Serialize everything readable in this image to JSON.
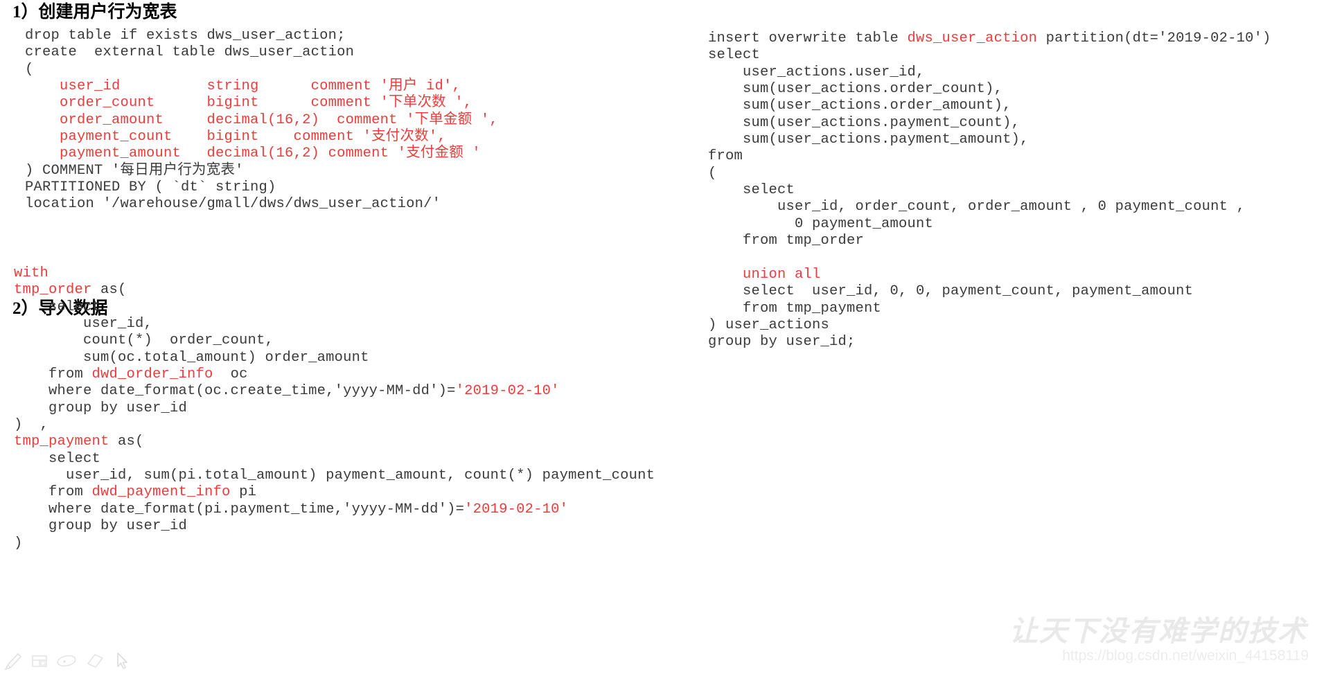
{
  "page": {
    "background_color": "#ffffff",
    "code_color": "#3b3b3b",
    "keyword_color": "#ef3b3b",
    "heading_color": "#000000"
  },
  "headings": {
    "section_1": "1）创建用户行为宽表",
    "section_2": "2）导入数据"
  },
  "code": {
    "create_table": [
      [
        {
          "t": "drop table if exists dws_user_action;",
          "c": "pln"
        }
      ],
      [
        {
          "t": "create  external table dws_user_action",
          "c": "pln"
        }
      ],
      [
        {
          "t": "(",
          "c": "pln"
        }
      ],
      [
        {
          "t": "    user_id          string      comment '用户 id',",
          "c": "kw"
        }
      ],
      [
        {
          "t": "    order_count      bigint      comment '下单次数 ',",
          "c": "kw"
        }
      ],
      [
        {
          "t": "    order_amount     decimal(16,2)  comment '下单金额 ',",
          "c": "kw"
        }
      ],
      [
        {
          "t": "    payment_count    bigint    comment '支付次数',",
          "c": "kw"
        }
      ],
      [
        {
          "t": "    payment_amount   decimal(16,2) comment '支付金额 '",
          "c": "kw"
        }
      ],
      [
        {
          "t": ") COMMENT '每日用户行为宽表'",
          "c": "pln"
        }
      ],
      [
        {
          "t": "PARTITIONED BY ( `dt` string)",
          "c": "pln"
        }
      ],
      [
        {
          "t": "location '/warehouse/gmall/dws/dws_user_action/'",
          "c": "pln"
        }
      ]
    ],
    "import_data": [
      [
        {
          "t": "with",
          "c": "kw"
        }
      ],
      [
        {
          "t": "tmp_order",
          "c": "kw"
        },
        {
          "t": " as(",
          "c": "pln"
        }
      ],
      [
        {
          "t": "    select",
          "c": "pln"
        }
      ],
      [
        {
          "t": "        user_id,",
          "c": "pln"
        }
      ],
      [
        {
          "t": "        count(*)  order_count,",
          "c": "pln"
        }
      ],
      [
        {
          "t": "        sum(oc.total_amount) order_amount",
          "c": "pln"
        }
      ],
      [
        {
          "t": "    from ",
          "c": "pln"
        },
        {
          "t": "dwd_order_info",
          "c": "kw"
        },
        {
          "t": "  oc",
          "c": "pln"
        }
      ],
      [
        {
          "t": "    where date_format(oc.create_time,'yyyy-MM-dd')=",
          "c": "pln"
        },
        {
          "t": "'2019-02-10'",
          "c": "kw"
        }
      ],
      [
        {
          "t": "    group by user_id",
          "c": "pln"
        }
      ],
      [
        {
          "t": ")  ,",
          "c": "pln"
        }
      ],
      [
        {
          "t": "tmp_payment",
          "c": "kw"
        },
        {
          "t": " as(",
          "c": "pln"
        }
      ],
      [
        {
          "t": "    select",
          "c": "pln"
        }
      ],
      [
        {
          "t": "      user_id, sum(pi.total_amount) payment_amount, count(*) payment_count",
          "c": "pln"
        }
      ],
      [
        {
          "t": "    from ",
          "c": "pln"
        },
        {
          "t": "dwd_payment_info",
          "c": "kw"
        },
        {
          "t": " pi",
          "c": "pln"
        }
      ],
      [
        {
          "t": "    where date_format(pi.payment_time,'yyyy-MM-dd')=",
          "c": "pln"
        },
        {
          "t": "'2019-02-10'",
          "c": "kw"
        }
      ],
      [
        {
          "t": "    group by user_id",
          "c": "pln"
        }
      ],
      [
        {
          "t": ")",
          "c": "pln"
        }
      ]
    ],
    "insert_overwrite": [
      [
        {
          "t": "insert overwrite table ",
          "c": "pln"
        },
        {
          "t": "dws_user_action",
          "c": "kw"
        },
        {
          "t": " partition(dt='2019-02-10')",
          "c": "pln"
        }
      ],
      [
        {
          "t": "select",
          "c": "pln"
        }
      ],
      [
        {
          "t": "    user_actions.user_id,",
          "c": "pln"
        }
      ],
      [
        {
          "t": "    sum(user_actions.order_count),",
          "c": "pln"
        }
      ],
      [
        {
          "t": "    sum(user_actions.order_amount),",
          "c": "pln"
        }
      ],
      [
        {
          "t": "    sum(user_actions.payment_count),",
          "c": "pln"
        }
      ],
      [
        {
          "t": "    sum(user_actions.payment_amount),",
          "c": "pln"
        }
      ],
      [
        {
          "t": "from",
          "c": "pln"
        }
      ],
      [
        {
          "t": "(",
          "c": "pln"
        }
      ],
      [
        {
          "t": "    select",
          "c": "pln"
        }
      ],
      [
        {
          "t": "        user_id, order_count, order_amount , 0 payment_count ,",
          "c": "pln"
        }
      ],
      [
        {
          "t": "          0 payment_amount",
          "c": "pln"
        }
      ],
      [
        {
          "t": "    from tmp_order",
          "c": "pln"
        }
      ],
      [
        {
          "t": "",
          "c": "pln"
        }
      ],
      [
        {
          "t": "    ",
          "c": "pln"
        },
        {
          "t": "union all",
          "c": "kw"
        }
      ],
      [
        {
          "t": "    select  user_id, 0, 0, payment_count, payment_amount",
          "c": "pln"
        }
      ],
      [
        {
          "t": "    from tmp_payment",
          "c": "pln"
        }
      ],
      [
        {
          "t": ") user_actions",
          "c": "pln"
        }
      ],
      [
        {
          "t": "group by user_id;",
          "c": "pln"
        }
      ]
    ]
  },
  "watermark": {
    "text_cn": "让天下没有难学的技术",
    "url": "https://blog.csdn.net/weixin_44158119"
  },
  "toolbar": {
    "icons": [
      {
        "name": "pen-icon",
        "label": "pen"
      },
      {
        "name": "table-icon",
        "label": "table"
      },
      {
        "name": "ellipse-icon",
        "label": "ellipse"
      },
      {
        "name": "eraser-icon",
        "label": "eraser"
      },
      {
        "name": "cursor-icon",
        "label": "cursor"
      }
    ]
  }
}
